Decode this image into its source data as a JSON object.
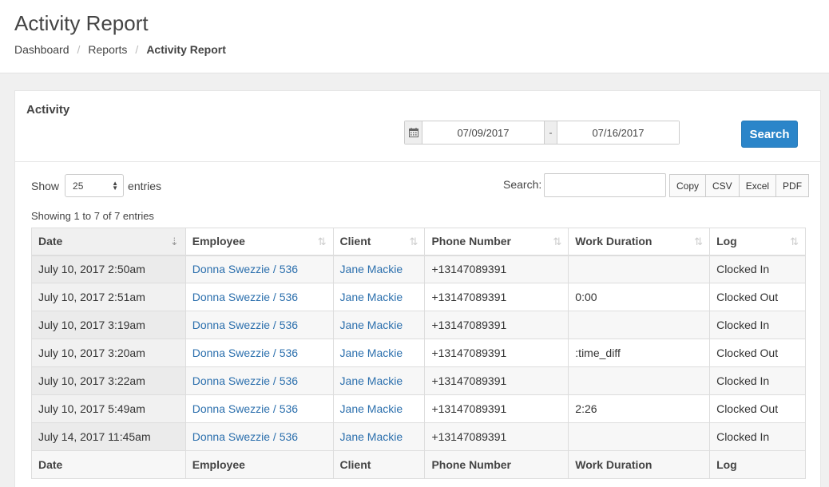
{
  "header": {
    "title": "Activity Report",
    "breadcrumb": [
      "Dashboard",
      "Reports",
      "Activity Report"
    ]
  },
  "panel": {
    "title": "Activity",
    "date_from": "07/09/2017",
    "date_separator": "-",
    "date_to": "07/16/2017",
    "search_button": "Search"
  },
  "controls": {
    "show_label": "Show",
    "page_length": "25",
    "entries_label": "entries",
    "search_label": "Search:",
    "search_value": "",
    "export_buttons": [
      "Copy",
      "CSV",
      "Excel",
      "PDF"
    ],
    "info": "Showing 1 to 7 of 7 entries"
  },
  "table": {
    "columns": [
      "Date",
      "Employee",
      "Client",
      "Phone Number",
      "Work Duration",
      "Log"
    ],
    "rows": [
      {
        "date": "July 10, 2017 2:50am",
        "employee": "Donna Swezzie / 536",
        "client": "Jane Mackie",
        "phone": "+13147089391",
        "duration": "",
        "log": "Clocked In"
      },
      {
        "date": "July 10, 2017 2:51am",
        "employee": "Donna Swezzie / 536",
        "client": "Jane Mackie",
        "phone": "+13147089391",
        "duration": "0:00",
        "log": "Clocked Out"
      },
      {
        "date": "July 10, 2017 3:19am",
        "employee": "Donna Swezzie / 536",
        "client": "Jane Mackie",
        "phone": "+13147089391",
        "duration": "",
        "log": "Clocked In"
      },
      {
        "date": "July 10, 2017 3:20am",
        "employee": "Donna Swezzie / 536",
        "client": "Jane Mackie",
        "phone": "+13147089391",
        "duration": ":time_diff",
        "log": "Clocked Out"
      },
      {
        "date": "July 10, 2017 3:22am",
        "employee": "Donna Swezzie / 536",
        "client": "Jane Mackie",
        "phone": "+13147089391",
        "duration": "",
        "log": "Clocked In"
      },
      {
        "date": "July 10, 2017 5:49am",
        "employee": "Donna Swezzie / 536",
        "client": "Jane Mackie",
        "phone": "+13147089391",
        "duration": "2:26",
        "log": "Clocked Out"
      },
      {
        "date": "July 14, 2017 11:45am",
        "employee": "Donna Swezzie / 536",
        "client": "Jane Mackie",
        "phone": "+13147089391",
        "duration": "",
        "log": "Clocked In"
      }
    ]
  },
  "colors": {
    "accent": "#2b85c9",
    "link": "#2b6fad"
  }
}
